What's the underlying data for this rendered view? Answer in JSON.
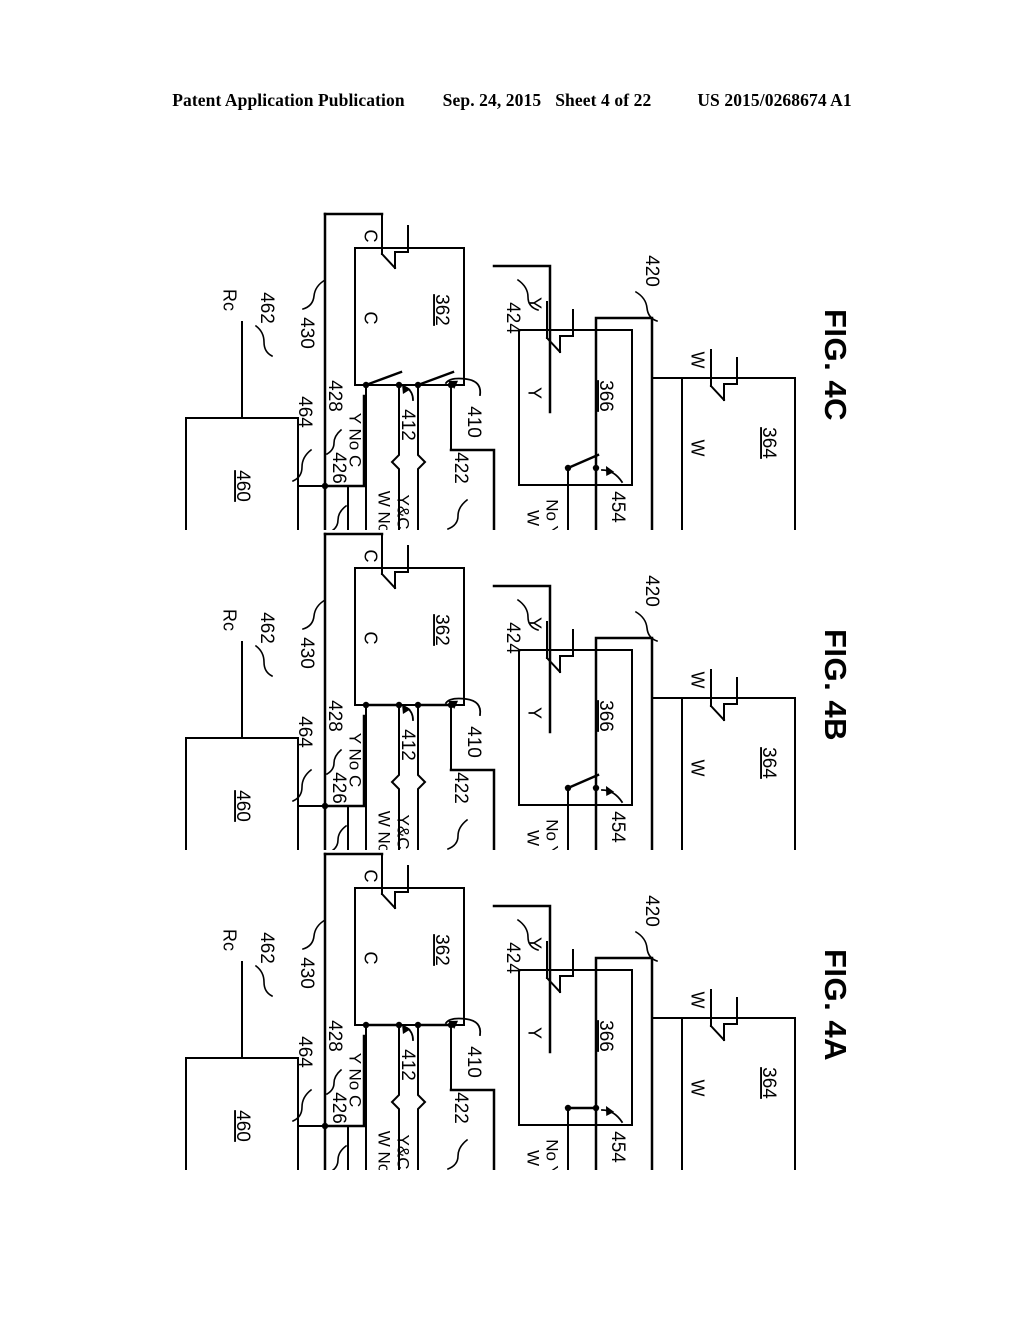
{
  "header": {
    "publication": "Patent Application Publication",
    "date": "Sep. 24, 2015",
    "sheet": "Sheet 4 of 22",
    "docket": "US 2015/0268674 A1"
  },
  "labels": {
    "rc": "Rc",
    "ref_462": "462",
    "ref_460": "460",
    "ref_464": "464",
    "ref_430": "430",
    "ref_428": "428",
    "ref_426": "426",
    "ref_362": "362",
    "ref_412": "412",
    "ref_410": "410",
    "ref_422": "422",
    "ref_424": "424",
    "ref_366": "366",
    "ref_454": "454",
    "ref_420": "420",
    "ref_364": "364",
    "y_no_c": "Y No C",
    "w_no_y_and_c_line1": "W No",
    "w_no_y_and_c_line2": "Y&C",
    "w_no_y_line1": "W",
    "w_no_y_line2": "No Y",
    "c_top": "C",
    "c_coil": "C",
    "y_top": "Y",
    "y_coil": "Y",
    "w_top": "W",
    "w_coil": "W"
  },
  "figures": [
    {
      "id": "4a",
      "caption": "FIG. 4A",
      "switch_412_closed": true,
      "switch_410_closed": true,
      "switch_454_closed": true
    },
    {
      "id": "4b",
      "caption": "FIG. 4B",
      "switch_412_closed": true,
      "switch_410_closed": true,
      "switch_454_closed": false
    },
    {
      "id": "4c",
      "caption": "FIG. 4C",
      "switch_412_closed": false,
      "switch_410_closed": false,
      "switch_454_closed": false
    }
  ],
  "colors": {
    "ink": "#000000",
    "paper": "#ffffff"
  }
}
